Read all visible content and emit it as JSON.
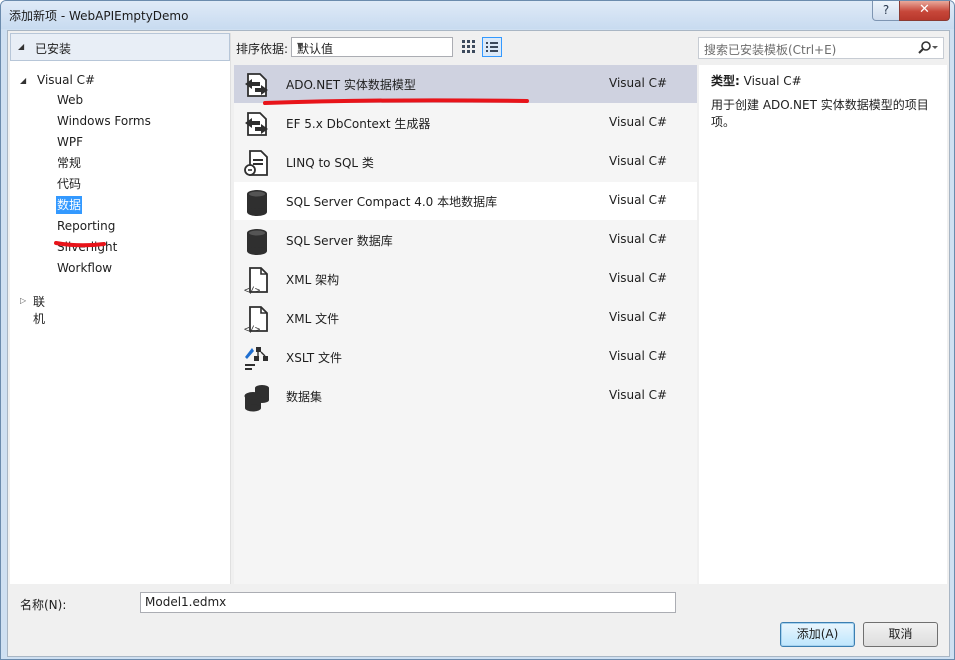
{
  "window": {
    "title": "添加新项 - WebAPIEmptyDemo",
    "help_label": "?",
    "close_label": "✕"
  },
  "left": {
    "installed_label": "已安装",
    "root_label": "Visual C#",
    "items": [
      "Web",
      "Windows Forms",
      "WPF",
      "常规",
      "代码",
      "数据",
      "Reporting",
      "Silverlight",
      "Workflow"
    ],
    "selected_index": 5,
    "online_label": "联机"
  },
  "toolbar": {
    "sort_label": "排序依据:",
    "sort_value": "默认值",
    "search_placeholder": "搜索已安装模板(Ctrl+E)"
  },
  "templates": [
    {
      "name": "ADO.NET 实体数据模型",
      "lang": "Visual C#",
      "icon": "ado-entity-icon"
    },
    {
      "name": "EF 5.x DbContext 生成器",
      "lang": "Visual C#",
      "icon": "ef-generator-icon"
    },
    {
      "name": "LINQ to SQL 类",
      "lang": "Visual C#",
      "icon": "linq-to-sql-icon"
    },
    {
      "name": "SQL Server Compact 4.0 本地数据库",
      "lang": "Visual C#",
      "icon": "database-icon"
    },
    {
      "name": "SQL Server 数据库",
      "lang": "Visual C#",
      "icon": "database-icon"
    },
    {
      "name": "XML 架构",
      "lang": "Visual C#",
      "icon": "xml-schema-icon"
    },
    {
      "name": "XML 文件",
      "lang": "Visual C#",
      "icon": "xml-file-icon"
    },
    {
      "name": "XSLT 文件",
      "lang": "Visual C#",
      "icon": "xslt-file-icon"
    },
    {
      "name": "数据集",
      "lang": "Visual C#",
      "icon": "dataset-icon"
    }
  ],
  "details": {
    "type_label": "类型:",
    "type_value": "Visual C#",
    "description": "用于创建 ADO.NET 实体数据模型的项目项。"
  },
  "bottom": {
    "name_label": "名称(N):",
    "name_value": "Model1.edmx",
    "add_label": "添加(A)",
    "cancel_label": "取消"
  },
  "colors": {
    "selection": "#3399ff",
    "selected_row": "#cfd2e0",
    "annotation": "#e8141a"
  }
}
